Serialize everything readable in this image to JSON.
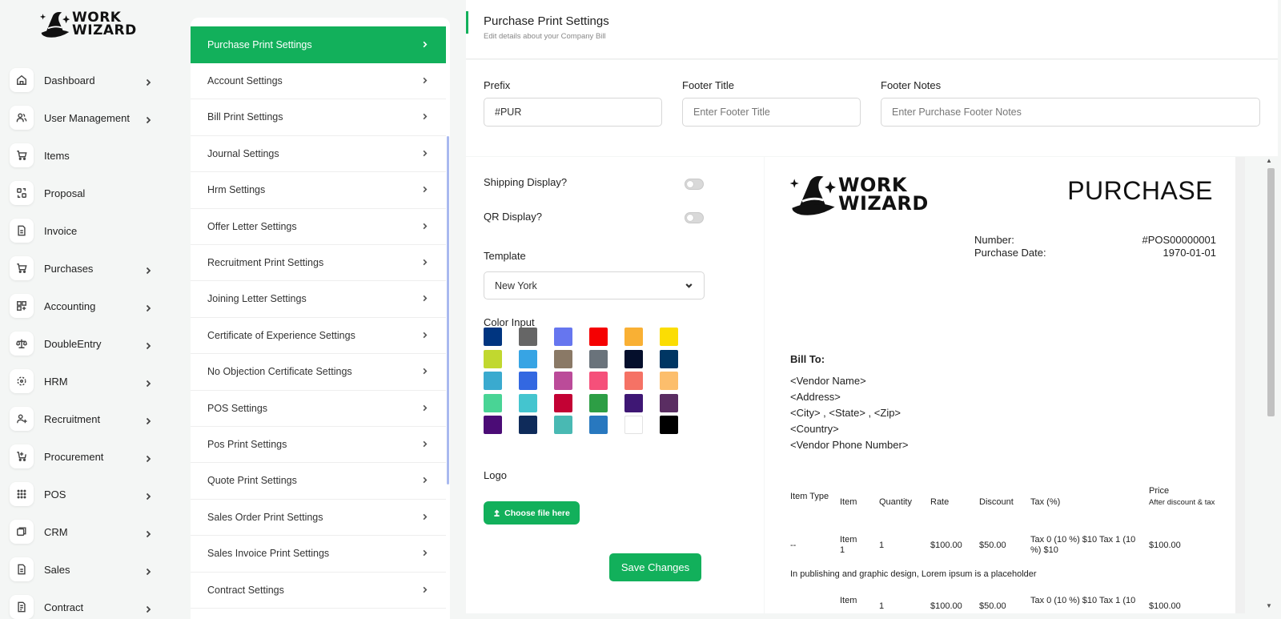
{
  "brand": {
    "logo_text_line1": "WORK",
    "logo_text_line2": "WIZARD"
  },
  "sidebar": {
    "items": [
      {
        "label": "Dashboard",
        "icon": "home-icon",
        "chevron": true
      },
      {
        "label": "User Management",
        "icon": "users-icon",
        "chevron": true
      },
      {
        "label": "Items",
        "icon": "cart-icon",
        "chevron": false
      },
      {
        "label": "Proposal",
        "icon": "swap-icon",
        "chevron": false
      },
      {
        "label": "Invoice",
        "icon": "file-icon",
        "chevron": false
      },
      {
        "label": "Purchases",
        "icon": "cart-icon",
        "chevron": true
      },
      {
        "label": "Accounting",
        "icon": "grid-plus-icon",
        "chevron": true
      },
      {
        "label": "DoubleEntry",
        "icon": "scale-icon",
        "chevron": true
      },
      {
        "label": "HRM",
        "icon": "hrm-icon",
        "chevron": true
      },
      {
        "label": "Recruitment",
        "icon": "user-plus-icon",
        "chevron": true
      },
      {
        "label": "Procurement",
        "icon": "procurement-icon",
        "chevron": true
      },
      {
        "label": "POS",
        "icon": "dots-grid-icon",
        "chevron": true
      },
      {
        "label": "CRM",
        "icon": "crm-icon",
        "chevron": true
      },
      {
        "label": "Sales",
        "icon": "file-icon",
        "chevron": true
      },
      {
        "label": "Contract",
        "icon": "contract-icon",
        "chevron": true
      }
    ]
  },
  "settings_menu": {
    "items": [
      {
        "label": "Purchase Print Settings",
        "active": true
      },
      {
        "label": "Account Settings"
      },
      {
        "label": "Bill Print Settings"
      },
      {
        "label": "Journal Settings"
      },
      {
        "label": "Hrm Settings"
      },
      {
        "label": "Offer Letter Settings"
      },
      {
        "label": "Recruitment Print Settings"
      },
      {
        "label": "Joining Letter Settings"
      },
      {
        "label": "Certificate of Experience Settings"
      },
      {
        "label": "No Objection Certificate Settings"
      },
      {
        "label": "POS Settings"
      },
      {
        "label": "Pos Print Settings"
      },
      {
        "label": "Quote Print Settings"
      },
      {
        "label": "Sales Order Print Settings"
      },
      {
        "label": "Sales Invoice Print Settings"
      },
      {
        "label": "Contract Settings"
      }
    ]
  },
  "header": {
    "title": "Purchase Print Settings",
    "subtitle": "Edit details about your Company Bill",
    "accent_color": "#12b05b"
  },
  "form": {
    "prefix": {
      "label": "Prefix",
      "value": "#PUR"
    },
    "footer_title": {
      "label": "Footer Title",
      "value": "",
      "placeholder": "Enter Footer Title"
    },
    "footer_notes": {
      "label": "Footer Notes",
      "value": "",
      "placeholder": "Enter Purchase Footer Notes"
    },
    "shipping_display": {
      "label": "Shipping Display?",
      "enabled": false
    },
    "qr_display": {
      "label": "QR Display?",
      "enabled": false
    },
    "template": {
      "label": "Template",
      "selected": "New York"
    },
    "color_input": {
      "label": "Color Input",
      "colors": [
        "#003580",
        "#666666",
        "#6676ef",
        "#f50102",
        "#f9b034",
        "#fbdd03",
        "#c1d82f",
        "#37a4e4",
        "#8a7966",
        "#6a737b",
        "#050f2c",
        "#003663",
        "#3aaacf",
        "#3368e1",
        "#bb4b99",
        "#f5507a",
        "#f57265",
        "#fcbe6c",
        "#49d495",
        "#44c5cf",
        "#c30234",
        "#2d9e45",
        "#3e1774",
        "#5a2d62",
        "#4b0c76",
        "#0f2b5a",
        "#49b9b3",
        "#2878bf",
        "#ffffff",
        "#000000"
      ]
    },
    "logo": {
      "label": "Logo",
      "button_label": "Choose file here"
    },
    "save_label": "Save Changes"
  },
  "preview": {
    "title": "PURCHASE",
    "number_label": "Number:",
    "number_value": "#POS00000001",
    "date_label": "Purchase Date:",
    "date_value": "1970-01-01",
    "bill_to": {
      "title": "Bill To:",
      "lines": [
        "<Vendor Name>",
        "<Address>",
        "<City> , <State> , <Zip>",
        "<Country>",
        "<Vendor Phone Number>"
      ]
    },
    "table": {
      "headers": {
        "item_type": "Item Type",
        "item": "Item",
        "quantity": "Quantity",
        "rate": "Rate",
        "discount": "Discount",
        "tax": "Tax (%)",
        "price": "Price",
        "price_note": "After discount & tax"
      },
      "rows": [
        {
          "item_type": "--",
          "item": "Item 1",
          "quantity": "1",
          "rate": "$100.00",
          "discount": "$50.00",
          "tax": "Tax 0 (10 %) $10 Tax 1 (10 %) $10",
          "price": "$100.00",
          "description": "In publishing and graphic design, Lorem ipsum is a placeholder"
        },
        {
          "item_type": "",
          "item": "Item",
          "quantity": "1",
          "rate": "$100.00",
          "discount": "$50.00",
          "tax": "Tax 0 (10 %) $10 Tax 1 (10",
          "price": "$100.00"
        }
      ]
    }
  }
}
